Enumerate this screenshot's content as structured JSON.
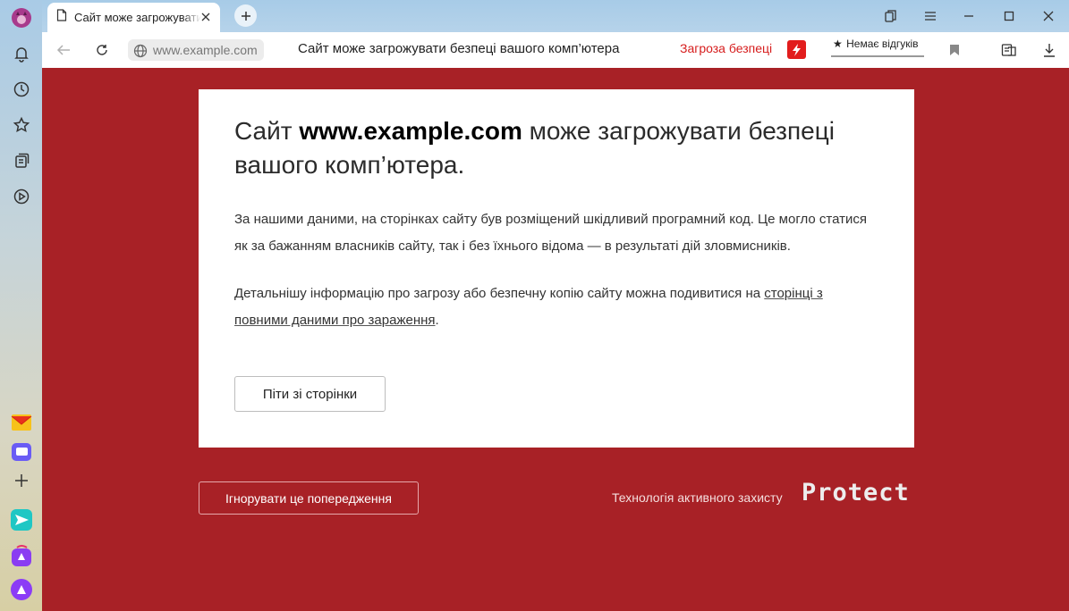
{
  "tab": {
    "title": "Сайт може загрожувати безпеці вашого комп’ютера"
  },
  "addressbar": {
    "domain": "www.example.com",
    "page_title": "Сайт може загрожувати безпеці вашого комп’ютера",
    "threat_label": "Загроза безпеці",
    "reviews_label": "Немає відгуків"
  },
  "card": {
    "heading_prefix": "Сайт ",
    "heading_domain": "www.example.com",
    "heading_suffix": " може загрожувати безпеці вашого комп’ютера.",
    "paragraph1": "За нашими даними, на сторінках сайту був розміщений шкідливий програмний код. Це могло статися як за бажанням власників сайту, так і без їхнього відома — в результаті дій зловмисників.",
    "paragraph2_text": "Детальнішу інформацію про загрозу або безпечну копію сайту можна подивитися на ",
    "paragraph2_link": "сторінці з повними даними про зараження",
    "paragraph2_end": ".",
    "leave_button": "Піти зі сторінки"
  },
  "footer": {
    "ignore_button": "Ігнорувати це попередження",
    "technology_label": "Технологія активного захисту",
    "protect_logo": "Protect"
  },
  "colors": {
    "page_background": "#a82126",
    "threat_red": "#d61d1d"
  }
}
